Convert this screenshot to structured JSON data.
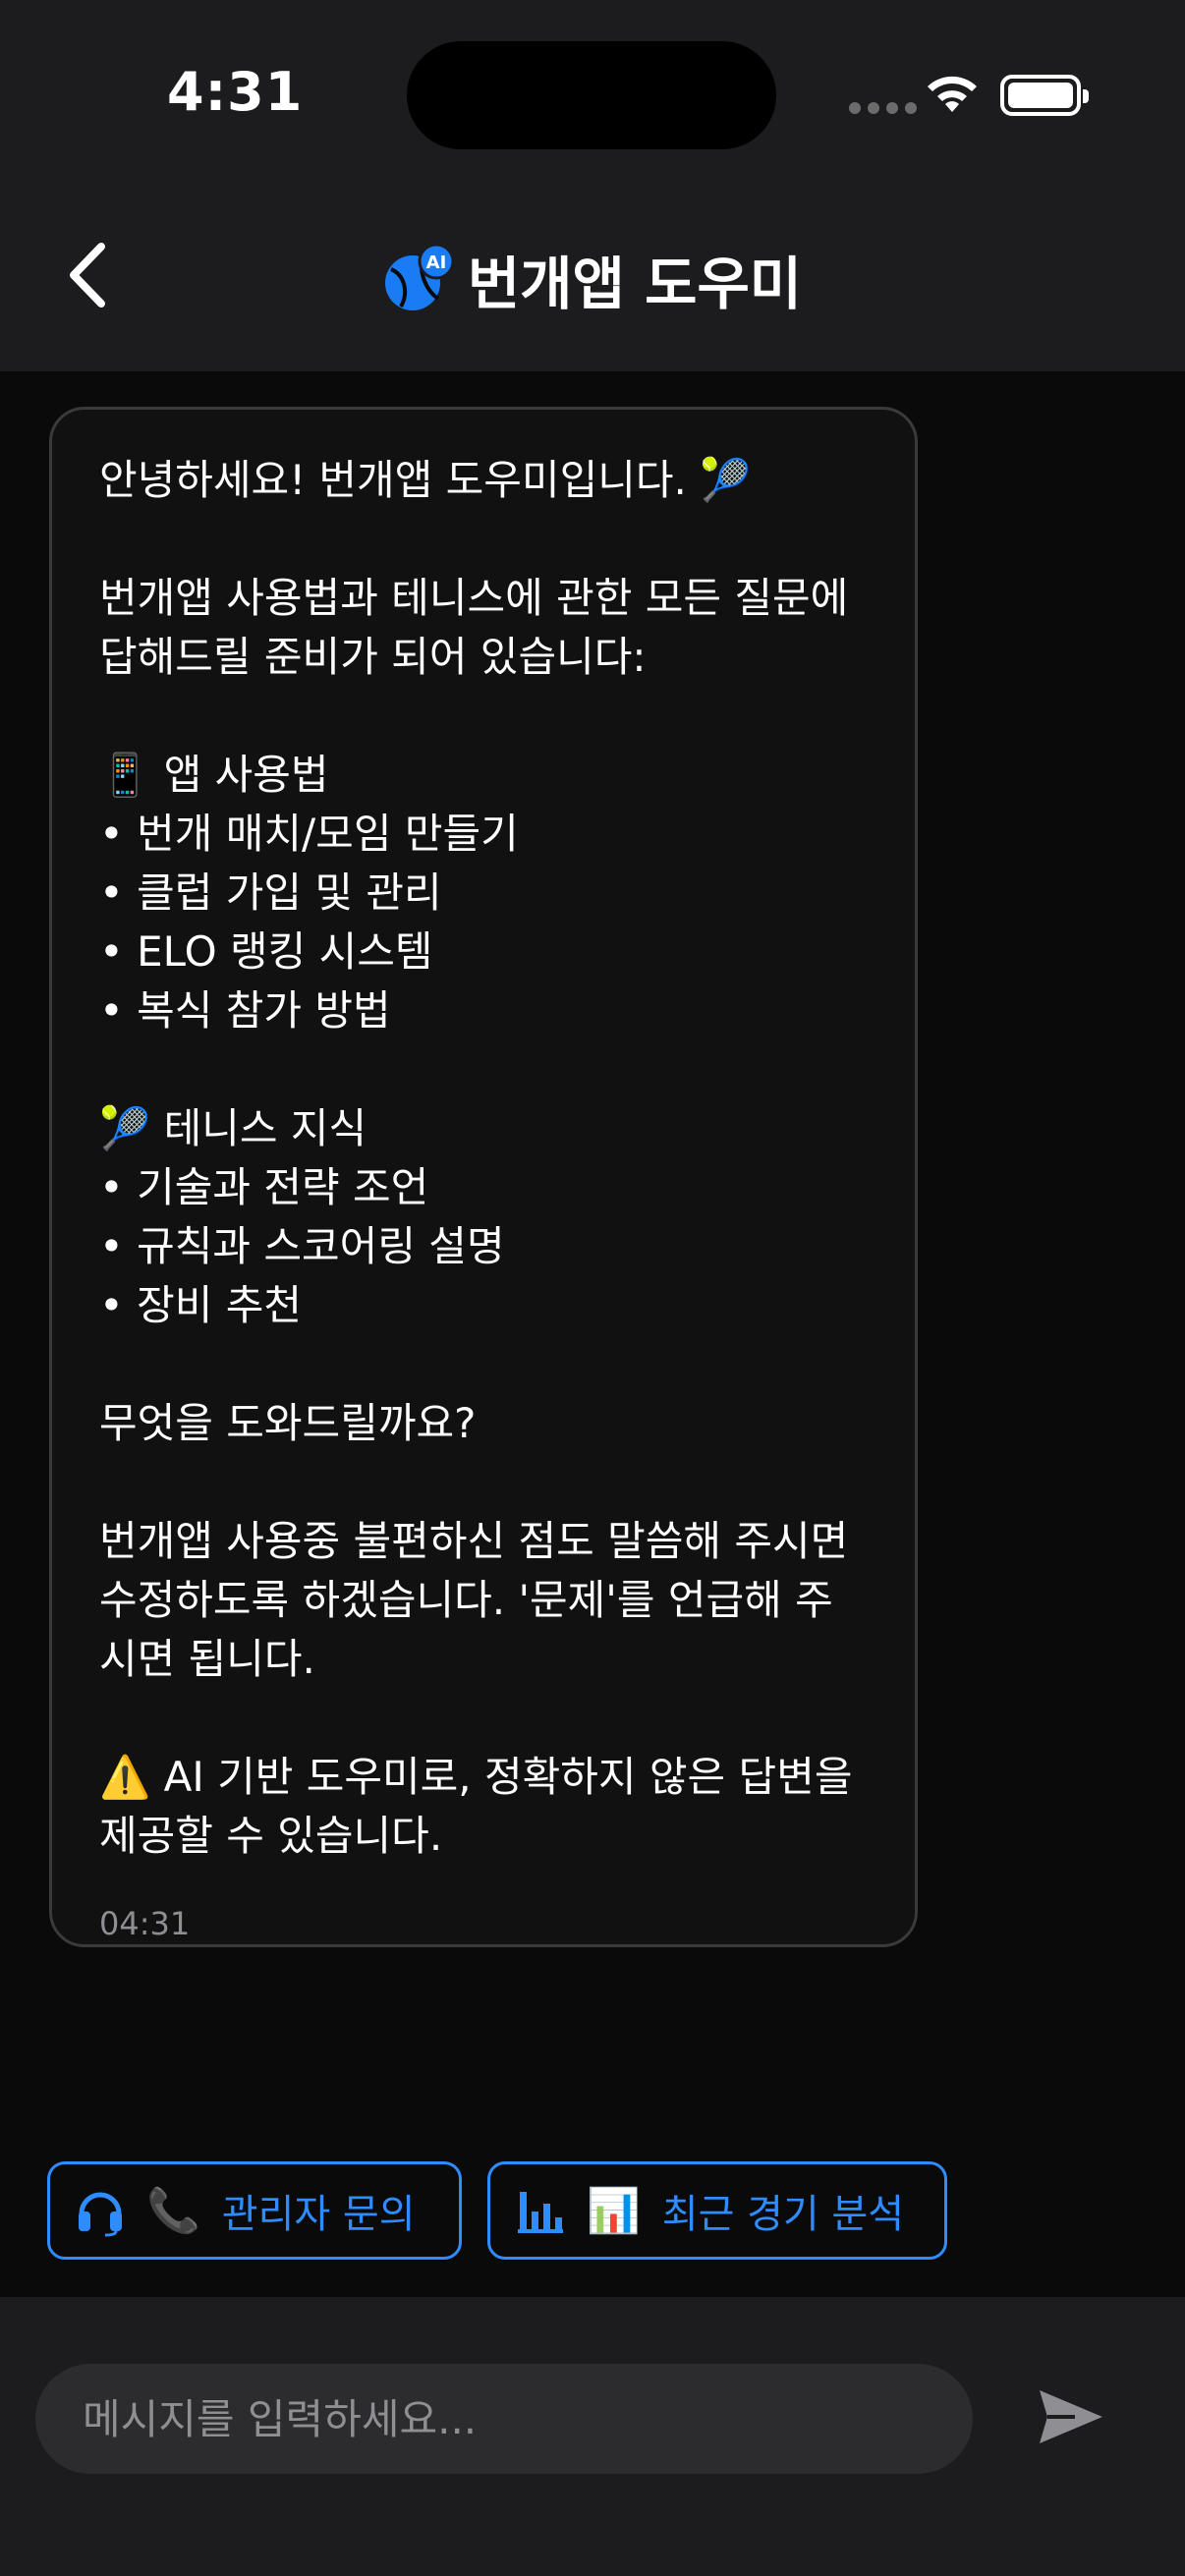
{
  "status_bar": {
    "time": "4:31"
  },
  "header": {
    "title": "번개앱 도우미",
    "logo_badge": "AI"
  },
  "message": {
    "text": "안녕하세요! 번개앱 도우미입니다. 🎾\n\n번개앱 사용법과 테니스에 관한 모든 질문에\n답해드릴 준비가 되어 있습니다:\n\n📱 앱 사용법\n• 번개 매치/모임 만들기\n• 클럽 가입 및 관리\n• ELO 랭킹 시스템\n• 복식 참가 방법\n\n🎾 테니스 지식\n• 기술과 전략 조언\n• 규칙과 스코어링 설명\n• 장비 추천\n\n무엇을 도와드릴까요?\n\n번개앱 사용중 불편하신 점도 말씀해 주시면\n수정하도록 하겠습니다. '문제'를 언급해 주\n시면 됩니다.\n\n⚠️ AI 기반 도우미로, 정확하지 않은 답변을\n제공할 수 있습니다.",
    "time": "04:31"
  },
  "quick_actions": [
    {
      "emoji": "📞",
      "label": "관리자 문의",
      "icon": "headset-icon"
    },
    {
      "emoji": "📊",
      "label": "최근 경기 분석",
      "icon": "bar-chart-icon"
    }
  ],
  "input": {
    "placeholder": "메시지를 입력하세요..."
  },
  "colors": {
    "accent": "#2e8cff",
    "background": "#0a0a0a",
    "surface": "#1c1c1e"
  }
}
